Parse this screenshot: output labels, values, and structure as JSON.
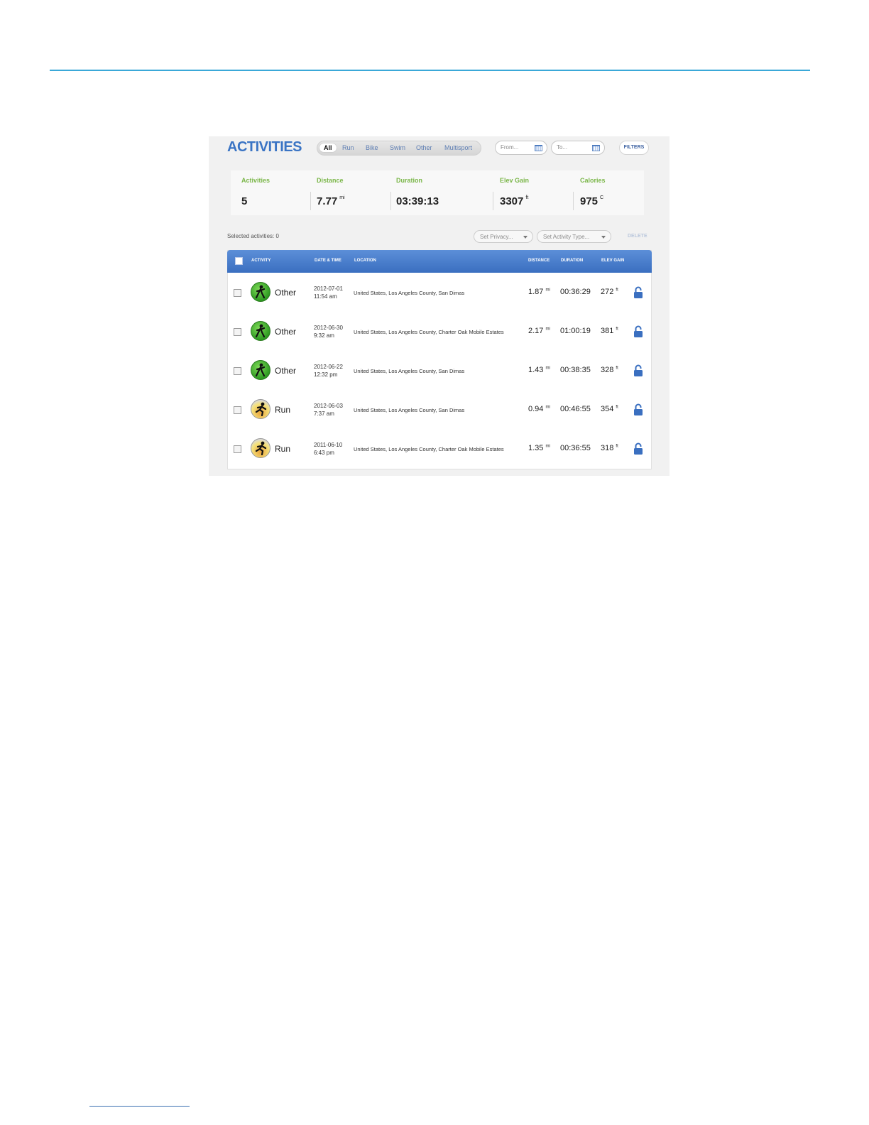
{
  "header": {
    "title": "ACTIVITIES",
    "tabs": [
      {
        "label": "All",
        "active": true
      },
      {
        "label": "Run",
        "active": false
      },
      {
        "label": "Bike",
        "active": false
      },
      {
        "label": "Swim",
        "active": false
      },
      {
        "label": "Other",
        "active": false
      },
      {
        "label": "Multisport",
        "active": false
      }
    ],
    "from_placeholder": "From...",
    "to_placeholder": "To...",
    "filters_label": "FILTERS"
  },
  "stats": [
    {
      "label": "Activities",
      "value": "5",
      "unit": ""
    },
    {
      "label": "Distance",
      "value": "7.77",
      "unit": "mi"
    },
    {
      "label": "Duration",
      "value": "03:39:13",
      "unit": ""
    },
    {
      "label": "Elev Gain",
      "value": "3307",
      "unit": "ft"
    },
    {
      "label": "Calories",
      "value": "975",
      "unit": "C"
    }
  ],
  "toolbar": {
    "selected_label": "Selected activities: 0",
    "privacy_dropdown": "Set Privacy...",
    "type_dropdown": "Set Activity Type...",
    "delete_label": "DELETE"
  },
  "table": {
    "columns": {
      "activity": "ACTIVITY",
      "datetime": "DATE & TIME",
      "location": "LOCATION",
      "distance": "DISTANCE",
      "duration": "DURATION",
      "elev_gain": "ELEV GAIN"
    },
    "rows": [
      {
        "type": "Other",
        "icon": "other",
        "date": "2012-07-01",
        "time": "11:54 am",
        "location": "United States, Los Angeles County, San Dimas",
        "distance": "1.87",
        "distance_unit": "mi",
        "duration": "00:36:29",
        "elev": "272",
        "elev_unit": "ft"
      },
      {
        "type": "Other",
        "icon": "other",
        "date": "2012-06-30",
        "time": "9:32 am",
        "location": "United States, Los Angeles County, Charter Oak Mobile Estates",
        "distance": "2.17",
        "distance_unit": "mi",
        "duration": "01:00:19",
        "elev": "381",
        "elev_unit": "ft"
      },
      {
        "type": "Other",
        "icon": "other",
        "date": "2012-06-22",
        "time": "12:32 pm",
        "location": "United States, Los Angeles County, San Dimas",
        "distance": "1.43",
        "distance_unit": "mi",
        "duration": "00:38:35",
        "elev": "328",
        "elev_unit": "ft"
      },
      {
        "type": "Run",
        "icon": "run",
        "date": "2012-06-03",
        "time": "7:37 am",
        "location": "United States, Los Angeles County, San Dimas",
        "distance": "0.94",
        "distance_unit": "mi",
        "duration": "00:46:55",
        "elev": "354",
        "elev_unit": "ft"
      },
      {
        "type": "Run",
        "icon": "run",
        "date": "2011-06-10",
        "time": "6:43 pm",
        "location": "United States, Los Angeles County, Charter Oak Mobile Estates",
        "distance": "1.35",
        "distance_unit": "mi",
        "duration": "00:36:55",
        "elev": "318",
        "elev_unit": "ft"
      }
    ]
  },
  "colors": {
    "accent": "#3a74c4",
    "stat_label": "#7ab648",
    "rule": "#3aa8d8"
  }
}
